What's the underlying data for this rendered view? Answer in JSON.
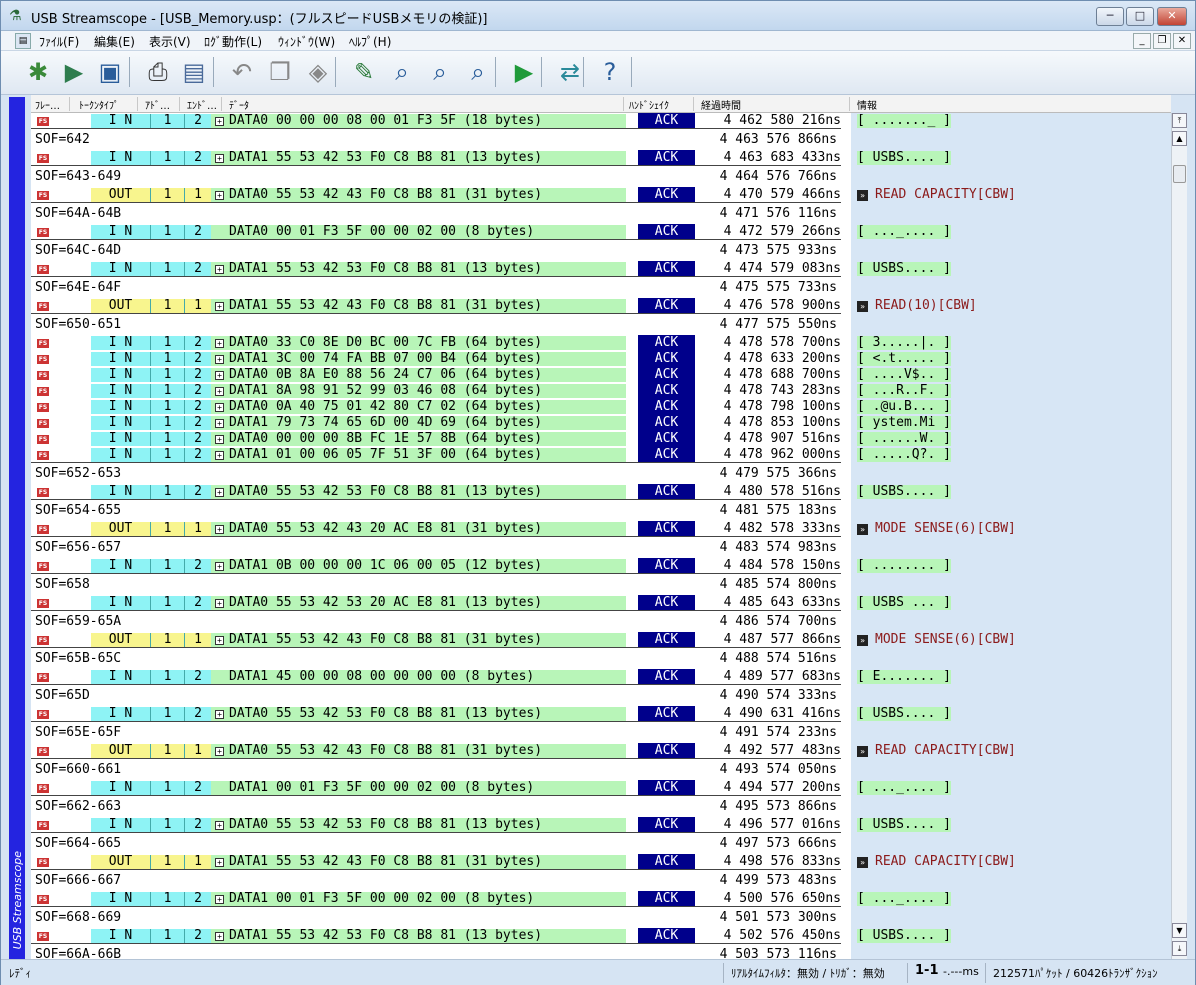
{
  "window": {
    "title": "USB Streamscope - [USB_Memory.usp：(フルスピードUSBメモリの検証)]",
    "min": "─",
    "max": "□",
    "close": "✕"
  },
  "menu": [
    "ﾌｧｲﾙ(F)",
    "編集(E)",
    "表示(V)",
    "ﾛｸﾞ動作(L)",
    "ｳｨﾝﾄﾞｳ(W)",
    "ﾍﾙﾌﾟ(H)"
  ],
  "toolbar": [
    {
      "icon": "new-capture-icon",
      "glyph": "✱",
      "color": "#3a8a3a"
    },
    {
      "icon": "open-icon",
      "glyph": "▶",
      "color": "#2e7d4e"
    },
    {
      "icon": "save-icon",
      "glyph": "▣",
      "color": "#2a5d9a"
    },
    {
      "icon": "print-icon",
      "glyph": "⎙",
      "color": "#333"
    },
    {
      "icon": "print-preview-icon",
      "glyph": "▤",
      "color": "#4a6a9a"
    },
    {
      "icon": "undo-icon",
      "glyph": "↶",
      "color": "#888"
    },
    {
      "icon": "copy-icon",
      "glyph": "❐",
      "color": "#888"
    },
    {
      "icon": "paste-icon",
      "glyph": "◈",
      "color": "#888"
    },
    {
      "icon": "edit-icon",
      "glyph": "✎",
      "color": "#2e7d3e"
    },
    {
      "icon": "search-icon",
      "glyph": "⌕",
      "color": "#2a5d9a"
    },
    {
      "icon": "search-next-icon",
      "glyph": "⌕",
      "color": "#2a5d9a"
    },
    {
      "icon": "search-prev-icon",
      "glyph": "⌕",
      "color": "#2a5d9a"
    },
    {
      "icon": "start-capture-icon",
      "glyph": "▶",
      "color": "#1f9a3a"
    },
    {
      "icon": "connect-icon",
      "glyph": "⇄",
      "color": "#2a8a9a"
    },
    {
      "icon": "help-icon",
      "glyph": "?",
      "color": "#2a5d9a"
    }
  ],
  "sidebar": {
    "label": "USB Streamscope"
  },
  "columns": {
    "frame": "ﾌﾚｰ…",
    "token": "ﾄｰｸﾝﾀｲﾌﾟ",
    "addr": "ｱﾄﾞ…",
    "ep": "ｴﾝﾄﾞ…",
    "data": "ﾃﾞｰﾀ",
    "handshake": "ﾊﾝﾄﾞｼｪｲｸ",
    "elapsed": "経過時間",
    "info": "情報"
  },
  "rows": [
    {
      "k": "t",
      "tok": "I N",
      "a": "1",
      "e": "2",
      "d": "DATA0 00 00 00 08 00 01 F3 5F (18 bytes)",
      "h": "ACK",
      "t": "4 462 580 216ns",
      "i": "[ ......._ ]",
      "it": "box"
    },
    {
      "k": "s",
      "s": "SOF=642",
      "t": "4 463 576 866ns"
    },
    {
      "k": "t",
      "tok": "I N",
      "a": "1",
      "e": "2",
      "d": "DATA1 55 53 42 53 F0 C8 B8 81 (13 bytes)",
      "h": "ACK",
      "t": "4 463 683 433ns",
      "i": "[ USBS.... ]",
      "it": "box"
    },
    {
      "k": "s",
      "s": "SOF=643-649",
      "t": "4 464 576 766ns"
    },
    {
      "k": "t",
      "tok": "OUT",
      "a": "1",
      "e": "1",
      "d": "DATA0 55 53 42 43 F0 C8 B8 81 (31 bytes)",
      "h": "ACK",
      "t": "4 470 579 466ns",
      "i": "READ CAPACITY[CBW]",
      "it": "cmd"
    },
    {
      "k": "s",
      "s": "SOF=64A-64B",
      "t": "4 471 576 116ns"
    },
    {
      "k": "t",
      "tok": "I N",
      "a": "1",
      "e": "2",
      "d": "DATA0 00 01 F3 5F 00 00 02 00 (8 bytes)",
      "nb": true,
      "h": "ACK",
      "t": "4 472 579 266ns",
      "i": "[ ..._.... ]",
      "it": "box"
    },
    {
      "k": "s",
      "s": "SOF=64C-64D",
      "t": "4 473 575 933ns"
    },
    {
      "k": "t",
      "tok": "I N",
      "a": "1",
      "e": "2",
      "d": "DATA1 55 53 42 53 F0 C8 B8 81 (13 bytes)",
      "h": "ACK",
      "t": "4 474 579 083ns",
      "i": "[ USBS.... ]",
      "it": "box"
    },
    {
      "k": "s",
      "s": "SOF=64E-64F",
      "t": "4 475 575 733ns"
    },
    {
      "k": "t",
      "tok": "OUT",
      "a": "1",
      "e": "1",
      "d": "DATA1 55 53 42 43 F0 C8 B8 81 (31 bytes)",
      "h": "ACK",
      "t": "4 476 578 900ns",
      "i": "READ(10)[CBW]",
      "it": "cmd"
    },
    {
      "k": "s",
      "s": "SOF=650-651",
      "t": "4 477 575 550ns"
    },
    {
      "k": "t",
      "tok": "I N",
      "a": "1",
      "e": "2",
      "d": "DATA0 33 C0 8E D0 BC 00 7C FB (64 bytes)",
      "h": "ACK",
      "t": "4 478 578 700ns",
      "i": "[ 3.....|. ]",
      "it": "box",
      "nl": true
    },
    {
      "k": "t",
      "tok": "I N",
      "a": "1",
      "e": "2",
      "d": "DATA1 3C 00 74 FA BB 07 00 B4 (64 bytes)",
      "h": "ACK",
      "t": "4 478 633 200ns",
      "i": "[ <.t..... ]",
      "it": "box",
      "nl": true
    },
    {
      "k": "t",
      "tok": "I N",
      "a": "1",
      "e": "2",
      "d": "DATA0 0B 8A E0 88 56 24 C7 06 (64 bytes)",
      "h": "ACK",
      "t": "4 478 688 700ns",
      "i": "[ ....V$.. ]",
      "it": "box",
      "nl": true
    },
    {
      "k": "t",
      "tok": "I N",
      "a": "1",
      "e": "2",
      "d": "DATA1 8A 98 91 52 99 03 46 08 (64 bytes)",
      "h": "ACK",
      "t": "4 478 743 283ns",
      "i": "[ ...R..F. ]",
      "it": "box",
      "nl": true
    },
    {
      "k": "t",
      "tok": "I N",
      "a": "1",
      "e": "2",
      "d": "DATA0 0A 40 75 01 42 80 C7 02 (64 bytes)",
      "h": "ACK",
      "t": "4 478 798 100ns",
      "i": "[ .@u.B... ]",
      "it": "box",
      "nl": true
    },
    {
      "k": "t",
      "tok": "I N",
      "a": "1",
      "e": "2",
      "d": "DATA1 79 73 74 65 6D 00 4D 69 (64 bytes)",
      "h": "ACK",
      "t": "4 478 853 100ns",
      "i": "[ ystem.Mi ]",
      "it": "box",
      "nl": true
    },
    {
      "k": "t",
      "tok": "I N",
      "a": "1",
      "e": "2",
      "d": "DATA0 00 00 00 8B FC 1E 57 8B (64 bytes)",
      "h": "ACK",
      "t": "4 478 907 516ns",
      "i": "[ ......W. ]",
      "it": "box",
      "nl": true
    },
    {
      "k": "t",
      "tok": "I N",
      "a": "1",
      "e": "2",
      "d": "DATA1 01 00 06 05 7F 51 3F 00 (64 bytes)",
      "h": "ACK",
      "t": "4 478 962 000ns",
      "i": "[ .....Q?. ]",
      "it": "box"
    },
    {
      "k": "s",
      "s": "SOF=652-653",
      "t": "4 479 575 366ns"
    },
    {
      "k": "t",
      "tok": "I N",
      "a": "1",
      "e": "2",
      "d": "DATA0 55 53 42 53 F0 C8 B8 81 (13 bytes)",
      "h": "ACK",
      "t": "4 480 578 516ns",
      "i": "[ USBS.... ]",
      "it": "box"
    },
    {
      "k": "s",
      "s": "SOF=654-655",
      "t": "4 481 575 183ns"
    },
    {
      "k": "t",
      "tok": "OUT",
      "a": "1",
      "e": "1",
      "d": "DATA0 55 53 42 43 20 AC E8 81 (31 bytes)",
      "h": "ACK",
      "t": "4 482 578 333ns",
      "i": "MODE SENSE(6)[CBW]",
      "it": "cmd"
    },
    {
      "k": "s",
      "s": "SOF=656-657",
      "t": "4 483 574 983ns"
    },
    {
      "k": "t",
      "tok": "I N",
      "a": "1",
      "e": "2",
      "d": "DATA1 0B 00 00 00 1C 06 00 05 (12 bytes)",
      "h": "ACK",
      "t": "4 484 578 150ns",
      "i": "[ ........ ]",
      "it": "box"
    },
    {
      "k": "s",
      "s": "SOF=658",
      "t": "4 485 574 800ns"
    },
    {
      "k": "t",
      "tok": "I N",
      "a": "1",
      "e": "2",
      "d": "DATA0 55 53 42 53 20 AC E8 81 (13 bytes)",
      "h": "ACK",
      "t": "4 485 643 633ns",
      "i": "[ USBS ... ]",
      "it": "box"
    },
    {
      "k": "s",
      "s": "SOF=659-65A",
      "t": "4 486 574 700ns"
    },
    {
      "k": "t",
      "tok": "OUT",
      "a": "1",
      "e": "1",
      "d": "DATA1 55 53 42 43 F0 C8 B8 81 (31 bytes)",
      "h": "ACK",
      "t": "4 487 577 866ns",
      "i": "MODE SENSE(6)[CBW]",
      "it": "cmd"
    },
    {
      "k": "s",
      "s": "SOF=65B-65C",
      "t": "4 488 574 516ns"
    },
    {
      "k": "t",
      "tok": "I N",
      "a": "1",
      "e": "2",
      "d": "DATA1 45 00 00 08 00 00 00 00 (8 bytes)",
      "nb": true,
      "h": "ACK",
      "t": "4 489 577 683ns",
      "i": "[ E....... ]",
      "it": "box"
    },
    {
      "k": "s",
      "s": "SOF=65D",
      "t": "4 490 574 333ns"
    },
    {
      "k": "t",
      "tok": "I N",
      "a": "1",
      "e": "2",
      "d": "DATA0 55 53 42 53 F0 C8 B8 81 (13 bytes)",
      "h": "ACK",
      "t": "4 490 631 416ns",
      "i": "[ USBS.... ]",
      "it": "box"
    },
    {
      "k": "s",
      "s": "SOF=65E-65F",
      "t": "4 491 574 233ns"
    },
    {
      "k": "t",
      "tok": "OUT",
      "a": "1",
      "e": "1",
      "d": "DATA0 55 53 42 43 F0 C8 B8 81 (31 bytes)",
      "h": "ACK",
      "t": "4 492 577 483ns",
      "i": "READ CAPACITY[CBW]",
      "it": "cmd"
    },
    {
      "k": "s",
      "s": "SOF=660-661",
      "t": "4 493 574 050ns"
    },
    {
      "k": "t",
      "tok": "I N",
      "a": "1",
      "e": "2",
      "d": "DATA1 00 01 F3 5F 00 00 02 00 (8 bytes)",
      "nb": true,
      "h": "ACK",
      "t": "4 494 577 200ns",
      "i": "[ ..._.... ]",
      "it": "box"
    },
    {
      "k": "s",
      "s": "SOF=662-663",
      "t": "4 495 573 866ns"
    },
    {
      "k": "t",
      "tok": "I N",
      "a": "1",
      "e": "2",
      "d": "DATA0 55 53 42 53 F0 C8 B8 81 (13 bytes)",
      "h": "ACK",
      "t": "4 496 577 016ns",
      "i": "[ USBS.... ]",
      "it": "box"
    },
    {
      "k": "s",
      "s": "SOF=664-665",
      "t": "4 497 573 666ns"
    },
    {
      "k": "t",
      "tok": "OUT",
      "a": "1",
      "e": "1",
      "d": "DATA1 55 53 42 43 F0 C8 B8 81 (31 bytes)",
      "h": "ACK",
      "t": "4 498 576 833ns",
      "i": "READ CAPACITY[CBW]",
      "it": "cmd"
    },
    {
      "k": "s",
      "s": "SOF=666-667",
      "t": "4 499 573 483ns"
    },
    {
      "k": "t",
      "tok": "I N",
      "a": "1",
      "e": "2",
      "d": "DATA1 00 01 F3 5F 00 00 02 00 (8 bytes)",
      "h": "ACK",
      "t": "4 500 576 650ns",
      "i": "[ ..._.... ]",
      "it": "box"
    },
    {
      "k": "s",
      "s": "SOF=668-669",
      "t": "4 501 573 300ns"
    },
    {
      "k": "t",
      "tok": "I N",
      "a": "1",
      "e": "2",
      "d": "DATA1 55 53 42 53 F0 C8 B8 81 (13 bytes)",
      "h": "ACK",
      "t": "4 502 576 450ns",
      "i": "[ USBS.... ]",
      "it": "box"
    },
    {
      "k": "s",
      "s": "SOF=66A-66B",
      "t": "4 503 573 116ns"
    }
  ],
  "status": {
    "ready": "ﾚﾃﾞｨ",
    "filter": "ﾘｱﾙﾀｲﾑﾌｨﾙﾀ：無効 / ﾄﾘｶﾞ：無効",
    "range": "1-1",
    "timer": "-.---ms",
    "counts": "212571ﾊﾟｹｯﾄ / 60426ﾄﾗﾝｻﾞｸｼｮﾝ"
  }
}
